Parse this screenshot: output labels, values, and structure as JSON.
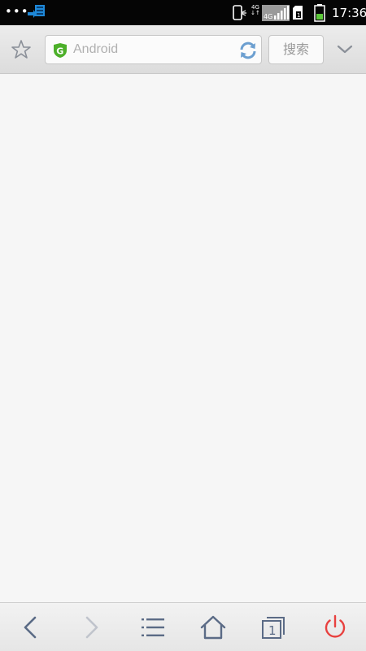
{
  "status_bar": {
    "dots": "•••",
    "network_label": "4G",
    "signal_label": "4G",
    "clock": "17:36",
    "icons": [
      "app-notification-icon",
      "phone-icon",
      "signal-icon",
      "sim-icon",
      "battery-icon"
    ]
  },
  "toolbar": {
    "url_placeholder": "Android",
    "search_label": "搜索",
    "icons": [
      "star-icon",
      "shield-icon",
      "refresh-icon",
      "chevron-down-icon"
    ]
  },
  "bottom_nav": {
    "tab_count": "1",
    "icons": [
      "back-icon",
      "forward-icon",
      "menu-icon",
      "home-icon",
      "tabs-icon",
      "power-icon"
    ]
  },
  "colors": {
    "status_bar_bg": "#050505",
    "toolbar_bg": "#e2e2e2",
    "content_bg": "#f6f6f6",
    "nav_icon": "#5b6b86",
    "nav_icon_disabled": "#c0c4cc",
    "power_red": "#e8413f",
    "shield_green": "#4caf29",
    "refresh_blue": "#6c9fd0"
  }
}
